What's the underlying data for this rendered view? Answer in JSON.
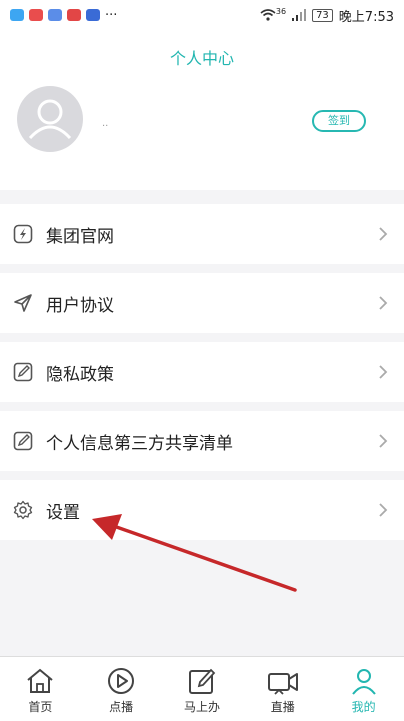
{
  "status_bar": {
    "signal": "36",
    "battery": "73",
    "time": "晚上7:53"
  },
  "header": {
    "title": "个人中心",
    "username": "..",
    "signin_label": "签到"
  },
  "menu": {
    "items": [
      {
        "label": "集团官网",
        "icon": "globe-icon"
      },
      {
        "label": "用户协议",
        "icon": "send-icon"
      },
      {
        "label": "隐私政策",
        "icon": "edit-icon"
      },
      {
        "label": "个人信息第三方共享清单",
        "icon": "edit-icon"
      },
      {
        "label": "设置",
        "icon": "gear-icon"
      }
    ]
  },
  "tabs": [
    {
      "label": "首页",
      "icon": "home-icon"
    },
    {
      "label": "点播",
      "icon": "play-icon"
    },
    {
      "label": "马上办",
      "icon": "edit-icon"
    },
    {
      "label": "直播",
      "icon": "camera-icon"
    },
    {
      "label": "我的",
      "icon": "user-icon",
      "active": true
    }
  ],
  "colors": {
    "accent": "#22b6b0",
    "arrow": "#c6282a"
  }
}
